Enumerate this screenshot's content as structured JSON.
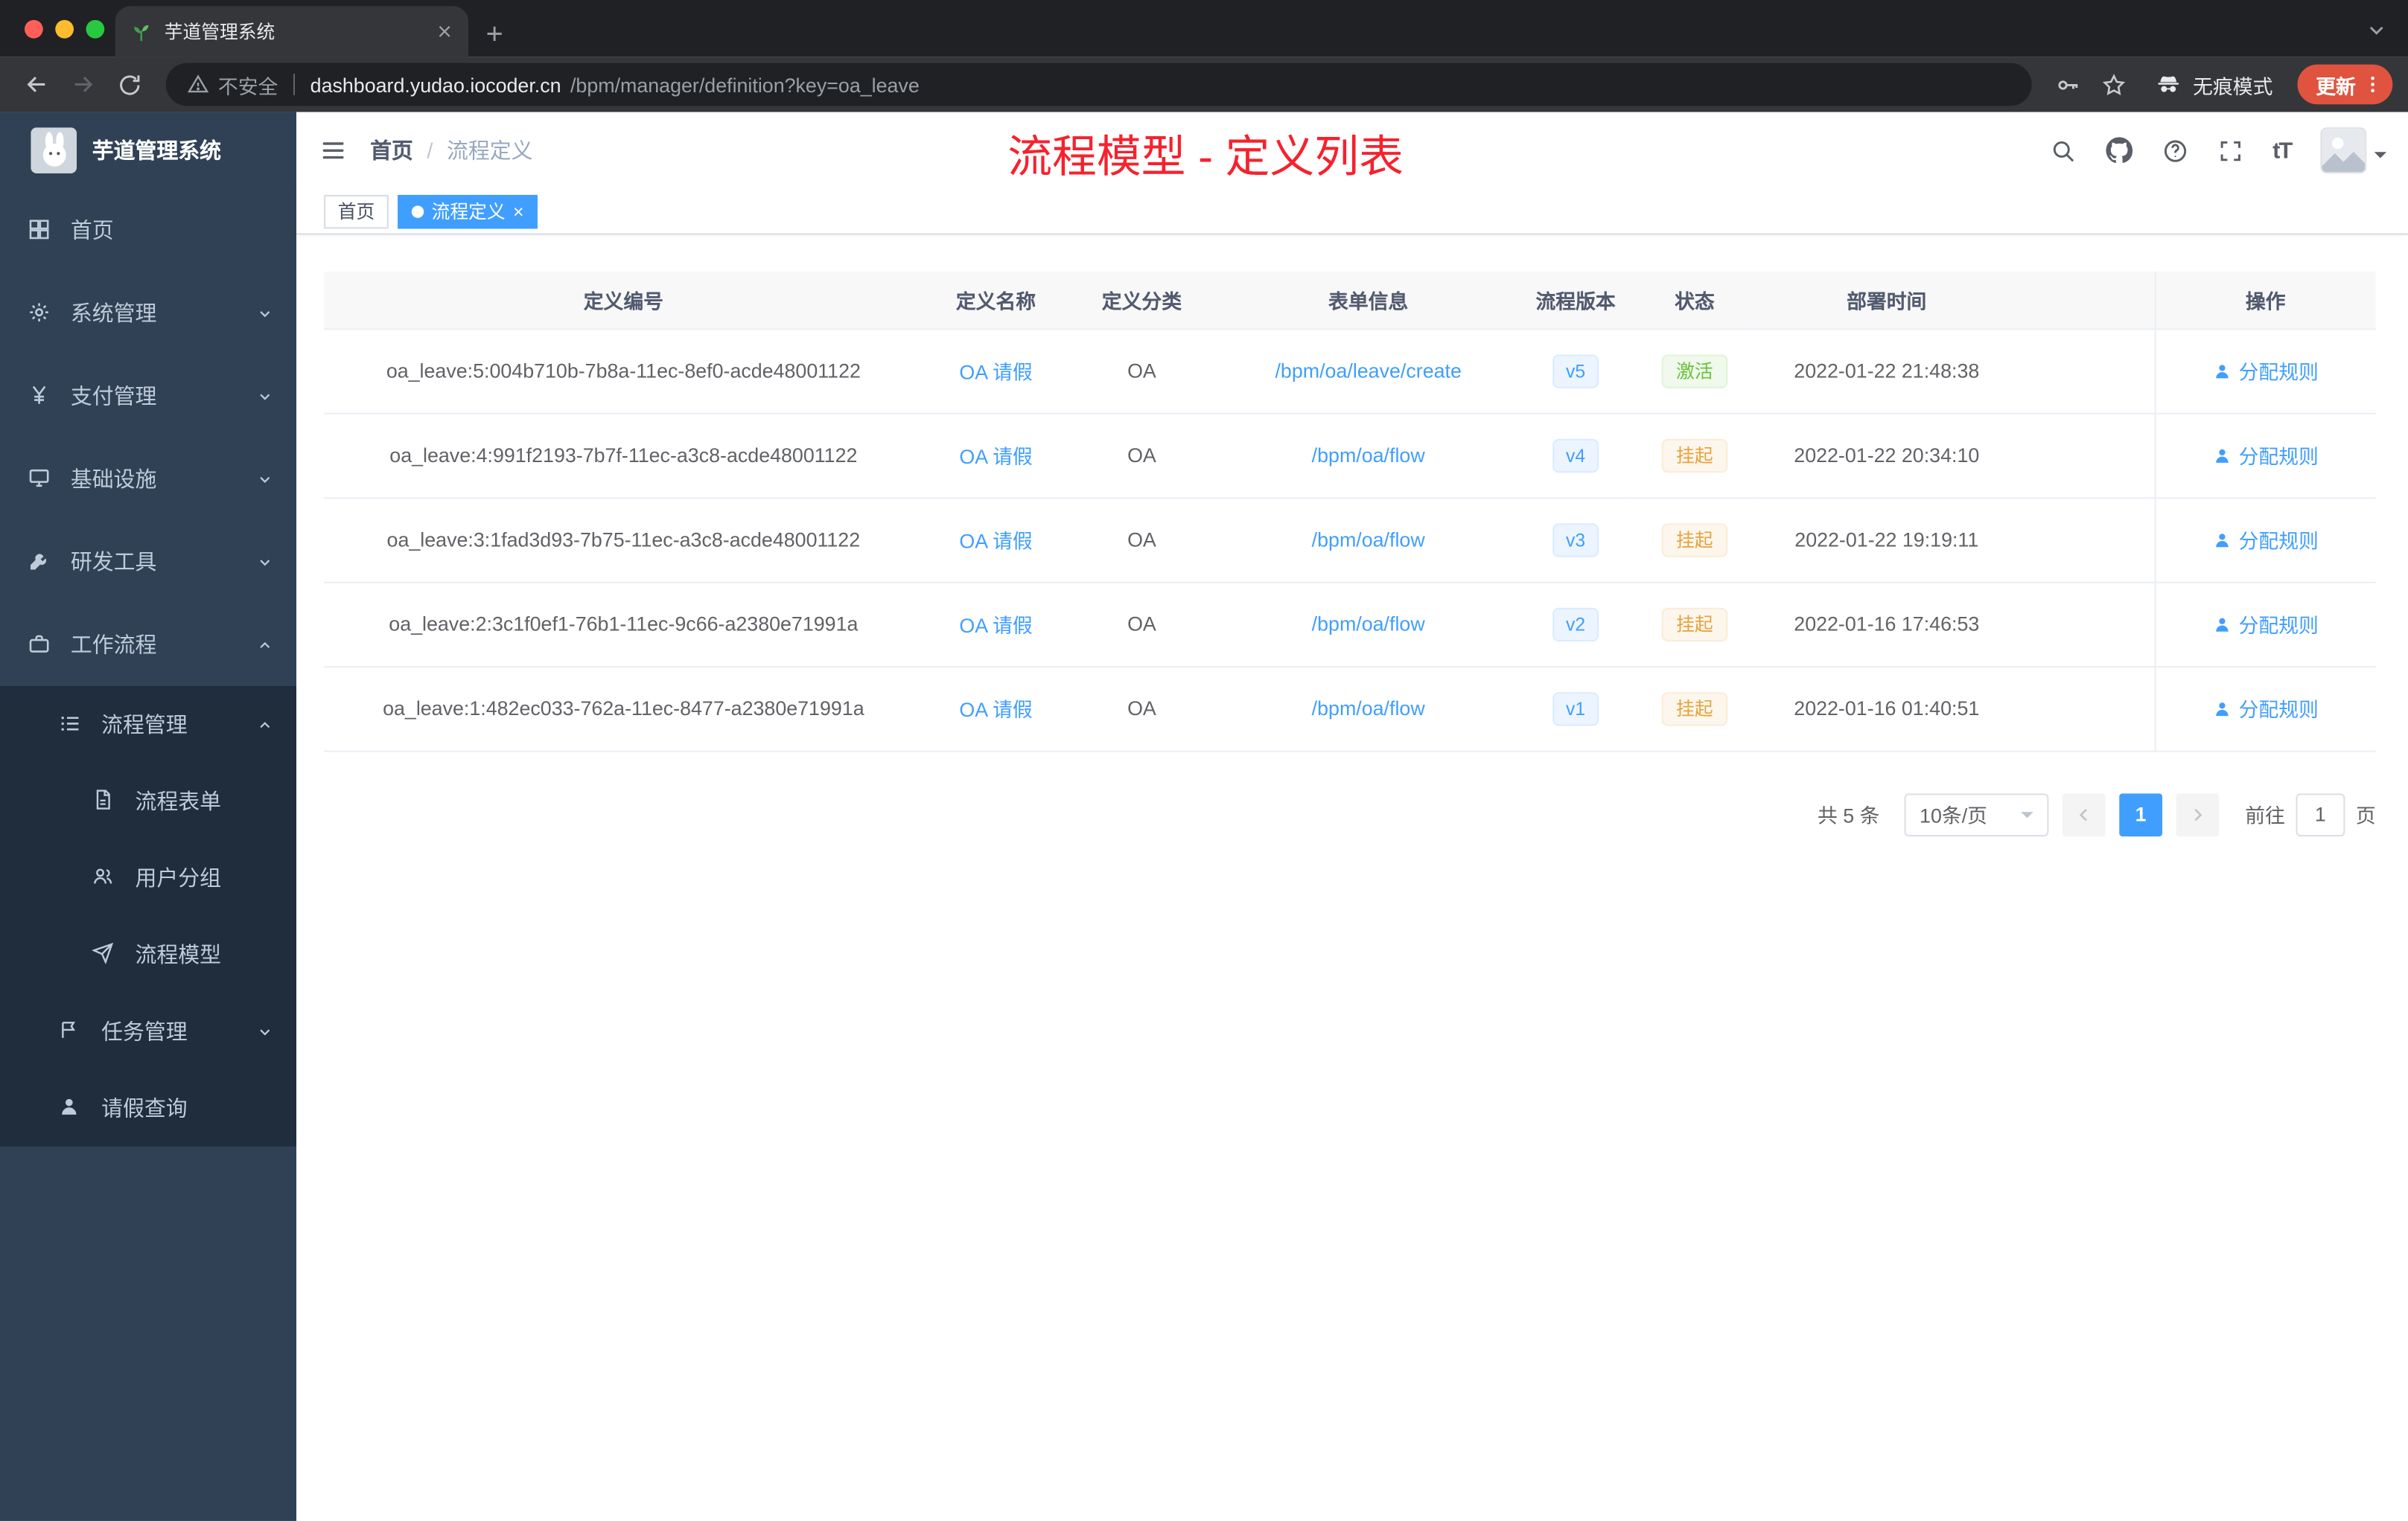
{
  "browser": {
    "tab_title": "芋道管理系统",
    "security_label": "不安全",
    "url_domain": "dashboard.yudao.iocoder.cn",
    "url_path": "/bpm/manager/definition?key=oa_leave",
    "incognito_label": "无痕模式",
    "update_label": "更新"
  },
  "sidebar": {
    "logo_title": "芋道管理系统",
    "items": [
      {
        "label": "首页"
      },
      {
        "label": "系统管理"
      },
      {
        "label": "支付管理"
      },
      {
        "label": "基础设施"
      },
      {
        "label": "研发工具"
      },
      {
        "label": "工作流程"
      },
      {
        "label": "流程管理"
      },
      {
        "label": "流程表单"
      },
      {
        "label": "用户分组"
      },
      {
        "label": "流程模型"
      },
      {
        "label": "任务管理"
      },
      {
        "label": "请假查询"
      }
    ]
  },
  "header": {
    "breadcrumb": {
      "home": "首页",
      "separator": "/",
      "current": "流程定义"
    },
    "annotation": "流程模型 - 定义列表"
  },
  "tags_view": {
    "tabs": [
      {
        "label": "首页",
        "active": false
      },
      {
        "label": "流程定义",
        "active": true
      }
    ]
  },
  "table": {
    "columns": [
      "定义编号",
      "定义名称",
      "定义分类",
      "表单信息",
      "流程版本",
      "状态",
      "部署时间",
      "操作"
    ],
    "rows": [
      {
        "id": "oa_leave:5:004b710b-7b8a-11ec-8ef0-acde48001122",
        "name": "OA 请假",
        "category": "OA",
        "form": "/bpm/oa/leave/create",
        "version": "v5",
        "status": "激活",
        "status_type": "success",
        "time": "2022-01-22 21:48:38",
        "action": "分配规则"
      },
      {
        "id": "oa_leave:4:991f2193-7b7f-11ec-a3c8-acde48001122",
        "name": "OA 请假",
        "category": "OA",
        "form": "/bpm/oa/flow",
        "version": "v4",
        "status": "挂起",
        "status_type": "warning",
        "time": "2022-01-22 20:34:10",
        "action": "分配规则"
      },
      {
        "id": "oa_leave:3:1fad3d93-7b75-11ec-a3c8-acde48001122",
        "name": "OA 请假",
        "category": "OA",
        "form": "/bpm/oa/flow",
        "version": "v3",
        "status": "挂起",
        "status_type": "warning",
        "time": "2022-01-22 19:19:11",
        "action": "分配规则"
      },
      {
        "id": "oa_leave:2:3c1f0ef1-76b1-11ec-9c66-a2380e71991a",
        "name": "OA 请假",
        "category": "OA",
        "form": "/bpm/oa/flow",
        "version": "v2",
        "status": "挂起",
        "status_type": "warning",
        "time": "2022-01-16 17:46:53",
        "action": "分配规则"
      },
      {
        "id": "oa_leave:1:482ec033-762a-11ec-8477-a2380e71991a",
        "name": "OA 请假",
        "category": "OA",
        "form": "/bpm/oa/flow",
        "version": "v1",
        "status": "挂起",
        "status_type": "warning",
        "time": "2022-01-16 01:40:51",
        "action": "分配规则"
      }
    ]
  },
  "pagination": {
    "total": "共 5 条",
    "page_size": "10条/页",
    "current_page": "1",
    "goto_label": "前往",
    "goto_value": "1",
    "page_unit": "页"
  },
  "icons": {
    "search": "magnifier",
    "github": "octocat-mark",
    "help": "question-circle",
    "fullscreen": "expand-corners",
    "font_size": "tT",
    "hamburger": "menu-lines",
    "warning": "triangle-exclamation",
    "incognito": "spy-glasses",
    "kebab": "vertical-dots"
  },
  "colors": {
    "accent_blue": "#409eff",
    "annotation_red": "#f5222d",
    "status_active_green": "#67c23a",
    "status_suspend_orange": "#e6a23c",
    "sidebar_bg": "#304156",
    "submenu_bg": "#1f2d3d"
  }
}
